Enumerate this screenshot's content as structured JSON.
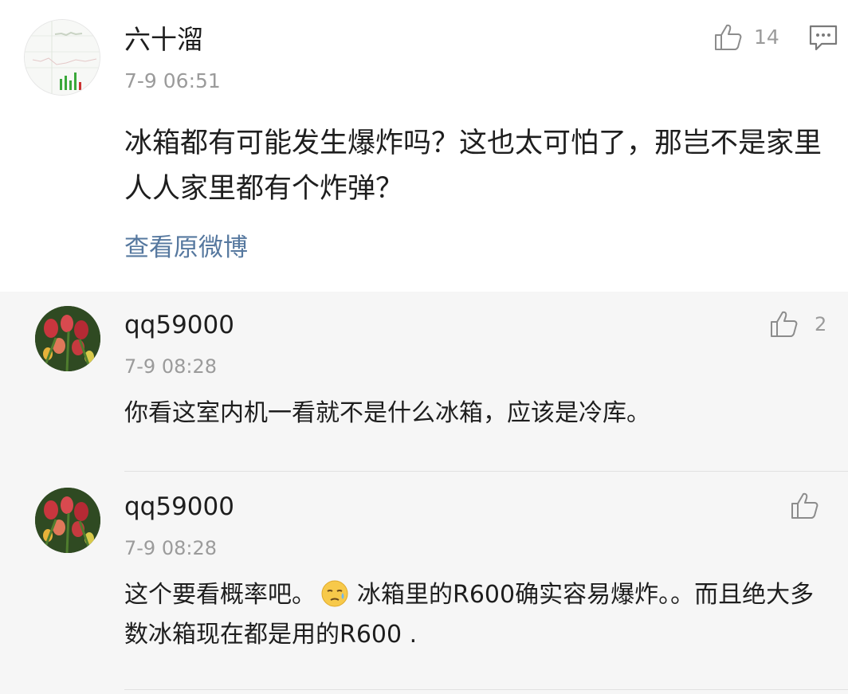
{
  "post": {
    "author": "六十溜",
    "time": "7-9 06:51",
    "like_count": "14",
    "text": "冰箱都有可能发生爆炸吗？这也太可怕了，那岂不是家里人人家里都有个炸弹？",
    "original_link": "查看原微博",
    "icons": {
      "like": "thumbs-up-icon",
      "comment": "comment-icon"
    }
  },
  "replies": [
    {
      "author": "qq59000",
      "time": "7-9 08:28",
      "like_count": "2",
      "text": "你看这室内机一看就不是什么冰箱，应该是冷库。"
    },
    {
      "author": "qq59000",
      "time": "7-9 08:28",
      "like_count": "",
      "text_before_emoji": "这个要看概率吧。",
      "emoji": "sweat-smile-emoji",
      "text_after_emoji": "冰箱里的R600确实容易爆炸。。而且绝大多数冰箱现在都是用的R600 ."
    }
  ],
  "colors": {
    "link": "#56789f",
    "secondary_text": "#9b9b9b",
    "reply_background": "#f6f6f6"
  }
}
